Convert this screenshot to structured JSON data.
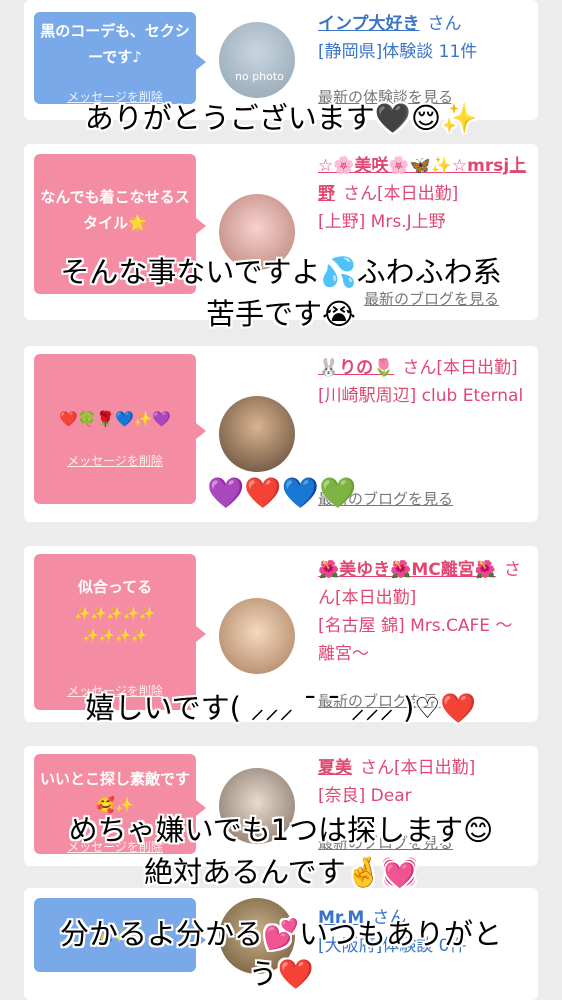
{
  "cards": [
    {
      "message": "黒のコーデも、セクシーです♪",
      "delete": "メッセージを削除",
      "name": "インプ大好き",
      "san": "さん",
      "detail": "[静岡県]体験談 11件",
      "more": "最新の体験談を見る",
      "photo": "no photo"
    },
    {
      "message": "なんでも着こなせるスタイル🌟",
      "delete": "",
      "name": "☆🌸美咲🌸🦋✨☆mrsj上野",
      "san": "さん[本日出勤]",
      "detail": "[上野] Mrs.J上野",
      "more": "最新のブログを見る"
    },
    {
      "message": "❤️🍀🌹💙✨💜",
      "delete": "メッセージを削除",
      "name": "🐰りの🌷",
      "san": "さん[本日出勤]",
      "detail": "[川崎駅周辺] club Eternal",
      "more": "最新のブログを見る"
    },
    {
      "message": "似合ってる",
      "sparkles": "✨✨✨✨✨ ✨✨✨✨",
      "delete": "メッセージを削除",
      "name": "🌺美ゆき🌺MC離宮🌺",
      "san": "さん[本日出勤]",
      "detail": "[名古屋 錦] Mrs.CAFE 〜離宮〜",
      "more": "最新のブログを見る"
    },
    {
      "message": "いいとこ探し素敵です🥰✨",
      "delete": "メッセージを削除",
      "name": "夏美",
      "san": "さん[本日出勤]",
      "detail": "[奈良] Dear",
      "more": "最新のブログを見る"
    },
    {
      "message": "🙏✨",
      "delete": "",
      "name": "Mr.M",
      "san": "さん",
      "detail": "[大阪府]体験談 0件",
      "more": ""
    }
  ],
  "overlays": {
    "line1": "ありがとうございます🖤😌✨",
    "line2a": "そんな事ないですよ💦ふわふわ系",
    "line2b": "苦手です😭",
    "hearts": "💜❤️💙💚",
    "line3": "嬉しいです( ⸝⸝⸝ ¯ ¯ ⸝⸝⸝ )♡❤️",
    "line4a": "めちゃ嫌いでも1つは探します😊",
    "line4b": "絶対あるんです🤞💓",
    "line5a": "分かるよ分かる💕いつもありがと",
    "line5b": "う❤️"
  }
}
